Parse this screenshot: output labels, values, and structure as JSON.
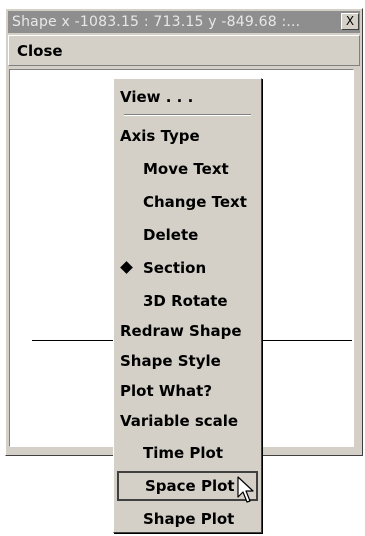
{
  "window": {
    "title": "Shape  x -1083.15 : 713.15  y -849.68 :...",
    "close_glyph": "X"
  },
  "menubar": {
    "close_label": "Close"
  },
  "popup_menu": {
    "items": [
      {
        "label": "View . . ."
      },
      {
        "label": "Axis Type"
      },
      {
        "label": "Move Text"
      },
      {
        "label": "Change Text"
      },
      {
        "label": "Delete"
      },
      {
        "label": "Section",
        "selected": true
      },
      {
        "label": "3D Rotate"
      },
      {
        "label": "Redraw Shape"
      },
      {
        "label": "Shape Style"
      },
      {
        "label": "Plot What?"
      },
      {
        "label": "Variable scale"
      },
      {
        "label": "Time Plot"
      },
      {
        "label": "Space Plot",
        "hovered": true
      },
      {
        "label": "Shape Plot"
      }
    ]
  },
  "icons": {
    "selected_marker": "diamond-icon",
    "pointer": "arrow-cursor-icon"
  },
  "colors": {
    "titlebar": "#8e8e8e",
    "face": "#d4d0c8"
  }
}
